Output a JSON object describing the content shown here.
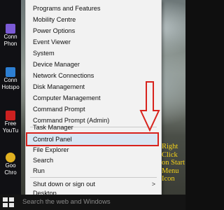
{
  "desktop_icons": [
    {
      "label": "Conn",
      "sub": "Phon",
      "icon": "device-icon",
      "color": "#7b5ad6"
    },
    {
      "label": "Conn",
      "sub": "Hotspo",
      "icon": "hotspot-icon",
      "color": "#2d7fd3"
    },
    {
      "label": "Free",
      "sub": "YouTu",
      "icon": "youtube-icon",
      "color": "#cc2020"
    },
    {
      "label": "Goo",
      "sub": "Chro",
      "icon": "chrome-icon",
      "color": "#e0b020"
    }
  ],
  "menu": {
    "items": [
      {
        "label": "Programs and Features"
      },
      {
        "label": "Mobility Centre"
      },
      {
        "label": "Power Options"
      },
      {
        "label": "Event Viewer"
      },
      {
        "label": "System"
      },
      {
        "label": "Device Manager"
      },
      {
        "label": "Network Connections"
      },
      {
        "label": "Disk Management"
      },
      {
        "label": "Computer Management"
      },
      {
        "label": "Command Prompt"
      },
      {
        "label": "Command Prompt (Admin)"
      },
      {
        "label": "Task Manager"
      },
      {
        "label": "Control Panel"
      },
      {
        "label": "File Explorer"
      },
      {
        "label": "Search"
      },
      {
        "label": "Run"
      },
      {
        "label": "Shut down or sign out",
        "chevron": ">"
      },
      {
        "label": "Desktop"
      }
    ],
    "highlighted": "Control Panel"
  },
  "annotation": {
    "lines": [
      "Right",
      "Click",
      "on Start",
      "Menu",
      "Icon"
    ],
    "color": "#f3d01a"
  },
  "taskbar": {
    "search_placeholder": "Search the web and Windows",
    "start_icon": "windows-logo-icon"
  },
  "colors": {
    "highlight_outline": "#d8231d",
    "highlight_fill": "#d9e6f3",
    "menu_bg": "#f2f2f2"
  }
}
